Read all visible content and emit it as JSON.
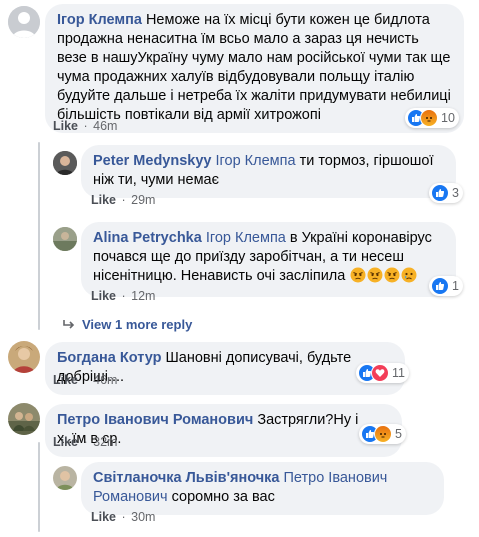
{
  "comments": [
    {
      "author": "Ігор Клемпа",
      "text": "Неможе на їх місці бути кожен це бидлота продажна ненаситна їм всьо мало а зараз ця нечисть везе в нашуУкраїну чуму мало нам російської чуми так ще чума продажних халуїв відбудовували польщу італію будуйте дальше і нетреба їх жаліти придумувати небилиці більшість повтікали від армії хитрожопі",
      "like_label": "Like",
      "time": "46m",
      "reaction_count": "10"
    },
    {
      "author": "Peter Medynskyy",
      "mention": "Ігор Клемпа",
      "text": "ти тормоз, гіршошої ніж ти, чуми немає",
      "like_label": "Like",
      "time": "29m",
      "reaction_count": "3"
    },
    {
      "author": "Alina Petrychka",
      "mention": "Ігор Клемпа",
      "text": "в Україні коронавірус почався ще до приїзду заробітчан, а ти несеш нісенітницю. Ненависть очі засліпила",
      "emoji": [
        "angry",
        "angry",
        "angry",
        "sad"
      ],
      "like_label": "Like",
      "time": "12m",
      "reaction_count": "1"
    },
    {
      "author": "Богдана Котур",
      "text": "Шановні дописувачі, будьте добріші....",
      "like_label": "Like",
      "time": "46m",
      "reaction_count": "11"
    },
    {
      "author": "Петро Іванович Романович",
      "text": "Застрягли?Ну і х..їм в ср.",
      "like_label": "Like",
      "time": "32m",
      "reaction_count": "5"
    },
    {
      "author": "Світланочка Львів'яночка",
      "mention": "Петро Іванович Романович",
      "text": "соромно за вас",
      "like_label": "Like",
      "time": "30m"
    }
  ],
  "view_more_label": "View 1 more reply",
  "separator": "·",
  "colors": {
    "author": "#385898",
    "bubble": "#f0f2f5",
    "like_reaction": "#1877f2",
    "love_reaction": "#f33e58",
    "angry_reaction": "#e9710f"
  }
}
